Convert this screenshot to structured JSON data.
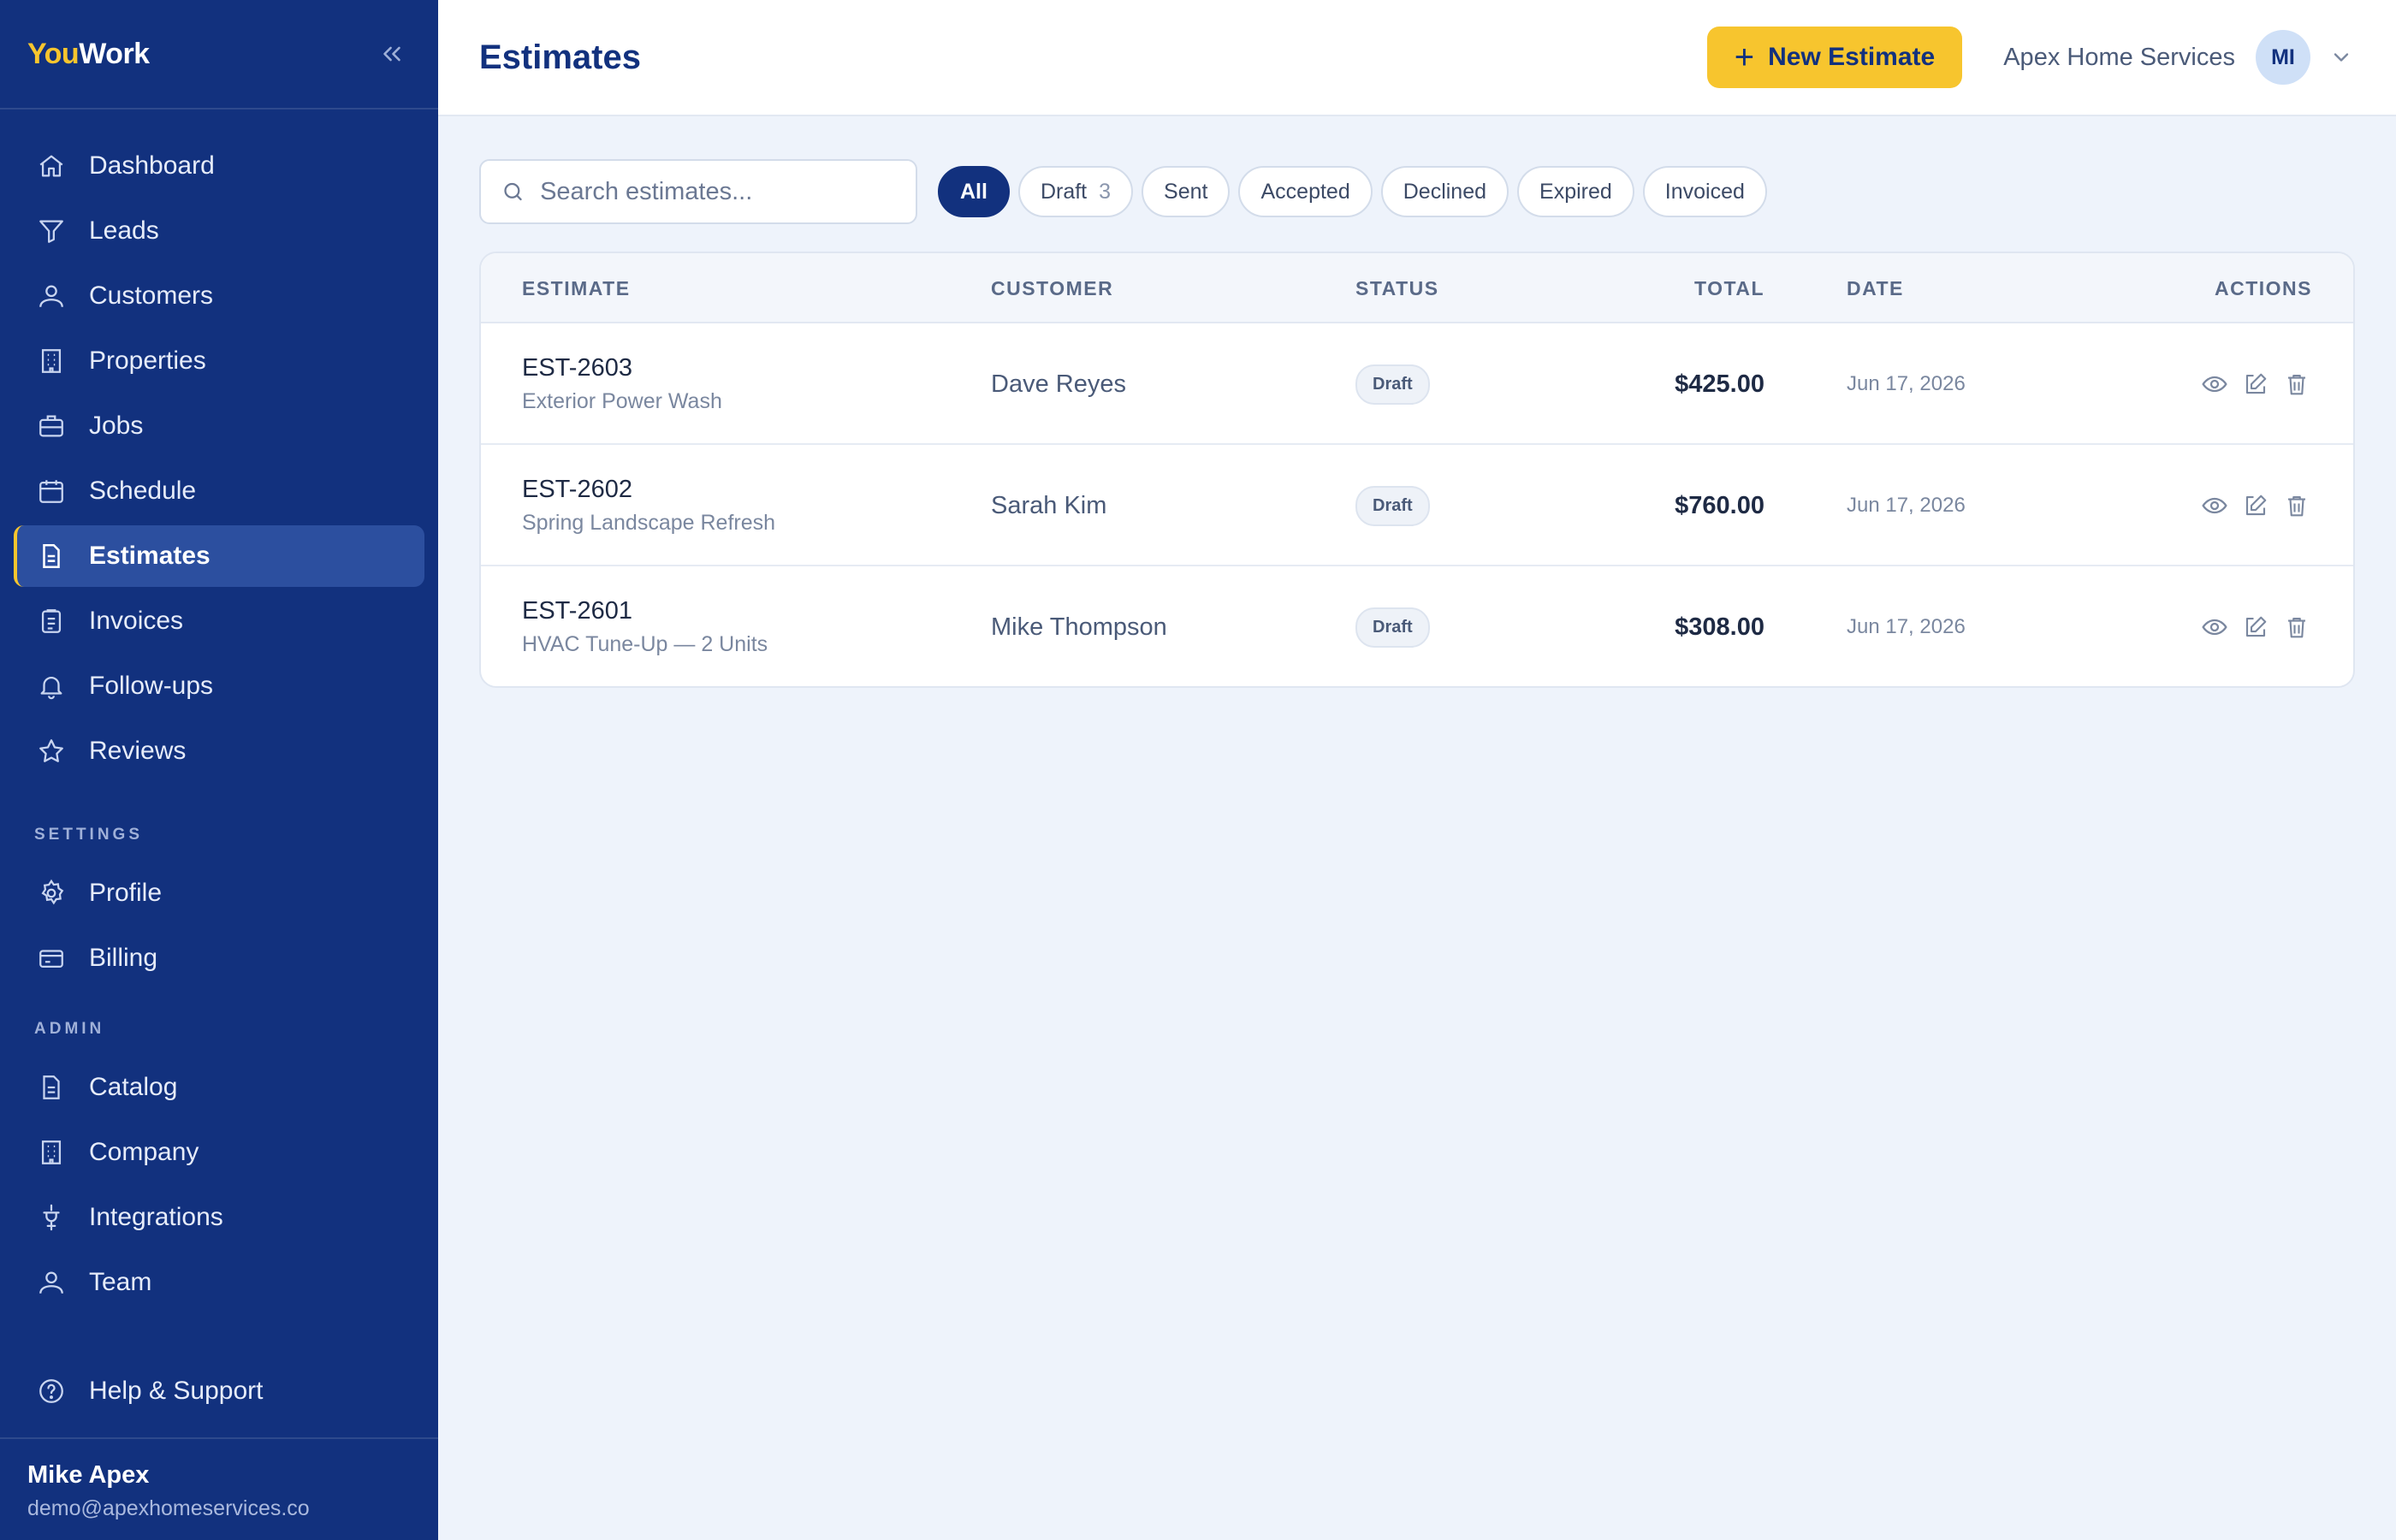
{
  "brand": {
    "part1": "You",
    "part2": "Work"
  },
  "sidebar": {
    "items": [
      {
        "label": "Dashboard",
        "icon": "home-icon"
      },
      {
        "label": "Leads",
        "icon": "funnel-icon"
      },
      {
        "label": "Customers",
        "icon": "user-icon"
      },
      {
        "label": "Properties",
        "icon": "building-icon"
      },
      {
        "label": "Jobs",
        "icon": "briefcase-icon"
      },
      {
        "label": "Schedule",
        "icon": "calendar-icon"
      },
      {
        "label": "Estimates",
        "icon": "document-icon",
        "active": true
      },
      {
        "label": "Invoices",
        "icon": "clipboard-icon"
      },
      {
        "label": "Follow-ups",
        "icon": "bell-icon"
      },
      {
        "label": "Reviews",
        "icon": "star-icon"
      }
    ],
    "settings_label": "SETTINGS",
    "settings_items": [
      {
        "label": "Profile",
        "icon": "gear-icon"
      },
      {
        "label": "Billing",
        "icon": "credit-card-icon"
      }
    ],
    "admin_label": "ADMIN",
    "admin_items": [
      {
        "label": "Catalog",
        "icon": "document-icon"
      },
      {
        "label": "Company",
        "icon": "building-icon"
      },
      {
        "label": "Integrations",
        "icon": "plug-icon"
      },
      {
        "label": "Team",
        "icon": "user-icon"
      }
    ],
    "help_label": "Help & Support",
    "user_name": "Mike Apex",
    "user_email": "demo@apexhomeservices.co"
  },
  "header": {
    "title": "Estimates",
    "new_button": "New Estimate",
    "company": "Apex Home Services",
    "avatar_initials": "MI"
  },
  "search": {
    "placeholder": "Search estimates..."
  },
  "filters": [
    {
      "label": "All",
      "active": true
    },
    {
      "label": "Draft",
      "count": "3"
    },
    {
      "label": "Sent"
    },
    {
      "label": "Accepted"
    },
    {
      "label": "Declined"
    },
    {
      "label": "Expired"
    },
    {
      "label": "Invoiced"
    }
  ],
  "table": {
    "columns": {
      "estimate": "ESTIMATE",
      "customer": "CUSTOMER",
      "status": "STATUS",
      "total": "TOTAL",
      "date": "DATE",
      "actions": "ACTIONS"
    },
    "rows": [
      {
        "id": "EST-2603",
        "desc": "Exterior Power Wash",
        "customer": "Dave Reyes",
        "status": "Draft",
        "total": "$425.00",
        "date": "Jun 17, 2026"
      },
      {
        "id": "EST-2602",
        "desc": "Spring Landscape Refresh",
        "customer": "Sarah Kim",
        "status": "Draft",
        "total": "$760.00",
        "date": "Jun 17, 2026"
      },
      {
        "id": "EST-2601",
        "desc": "HVAC Tune-Up — 2 Units",
        "customer": "Mike Thompson",
        "status": "Draft",
        "total": "$308.00",
        "date": "Jun 17, 2026"
      }
    ]
  },
  "colors": {
    "sidebar": "#12317e",
    "accent": "#f7c52e",
    "background": "#eef3fb"
  }
}
